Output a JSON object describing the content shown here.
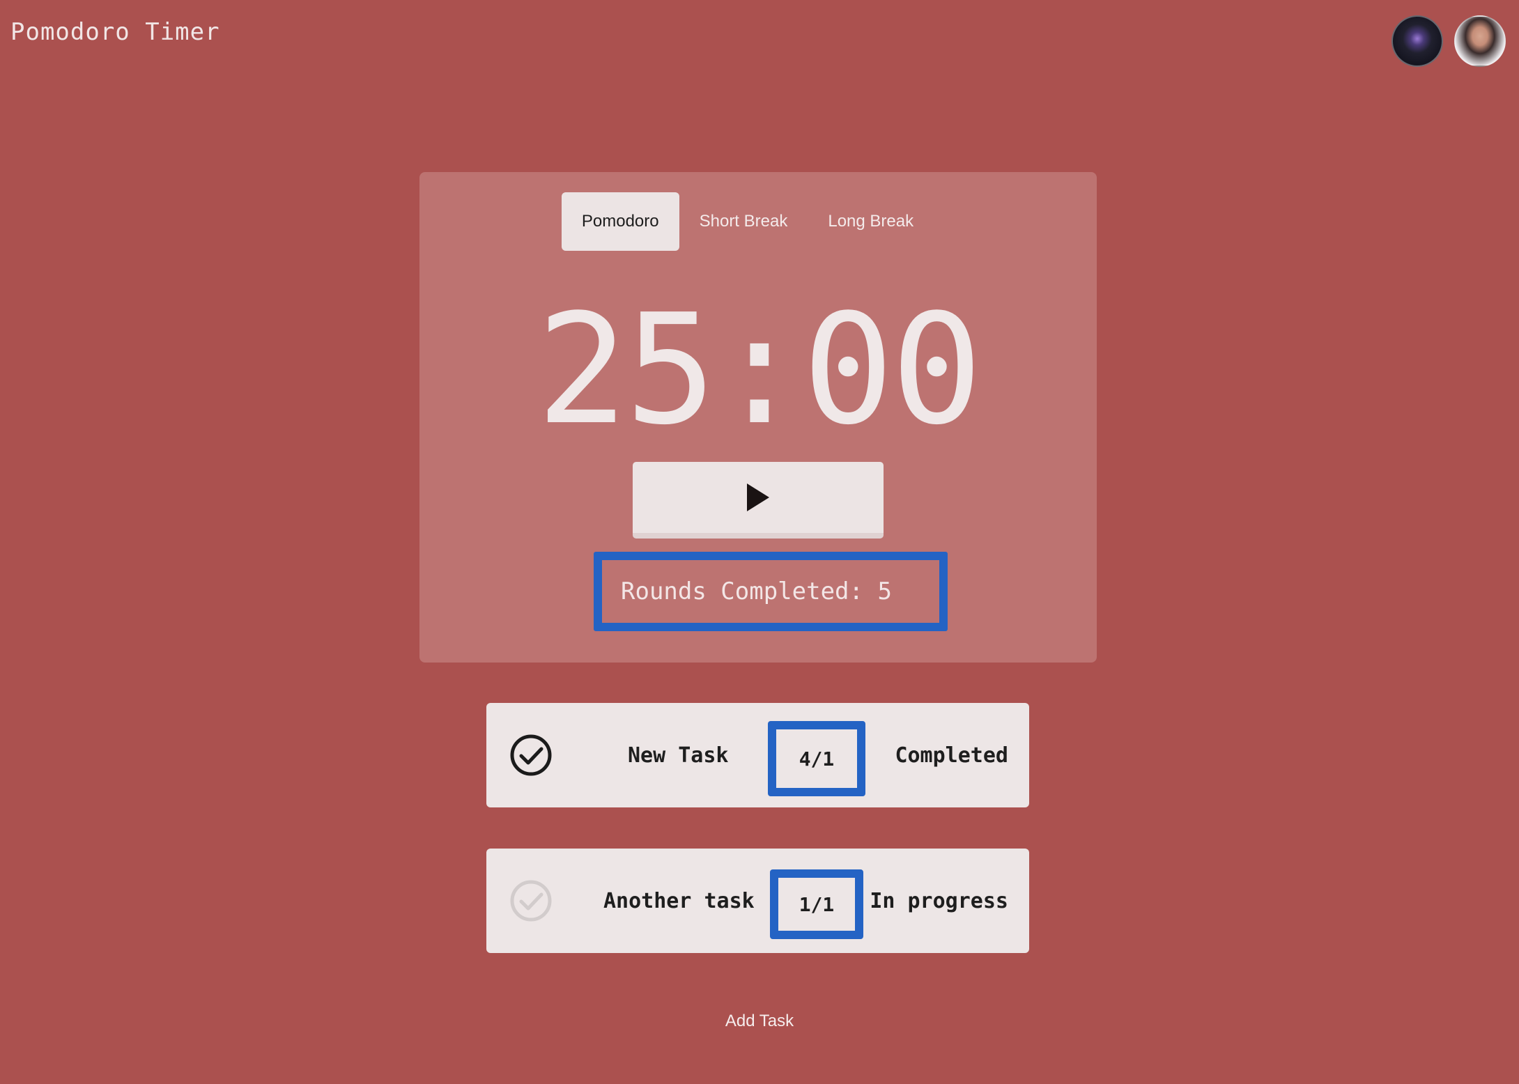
{
  "app": {
    "title": "Pomodoro Timer"
  },
  "header": {
    "avatars": [
      "avatar-1",
      "avatar-2"
    ]
  },
  "tabs": [
    {
      "label": "Pomodoro",
      "active": true
    },
    {
      "label": "Short Break",
      "active": false
    },
    {
      "label": "Long Break",
      "active": false
    }
  ],
  "timer": {
    "display": "25:00"
  },
  "controls": {
    "start_icon": "play-icon"
  },
  "rounds": {
    "label": "Rounds Completed: 5"
  },
  "tasks": [
    {
      "name": "New Task",
      "count": "4/1",
      "status": "Completed",
      "done": true
    },
    {
      "name": "Another task",
      "count": "1/1",
      "status": "In progress",
      "done": false
    }
  ],
  "add_task": {
    "label": "Add Task"
  },
  "colors": {
    "background": "#ab514f",
    "panel": "#bd7371",
    "highlight": "#2463c4",
    "card": "#ede6e6"
  }
}
